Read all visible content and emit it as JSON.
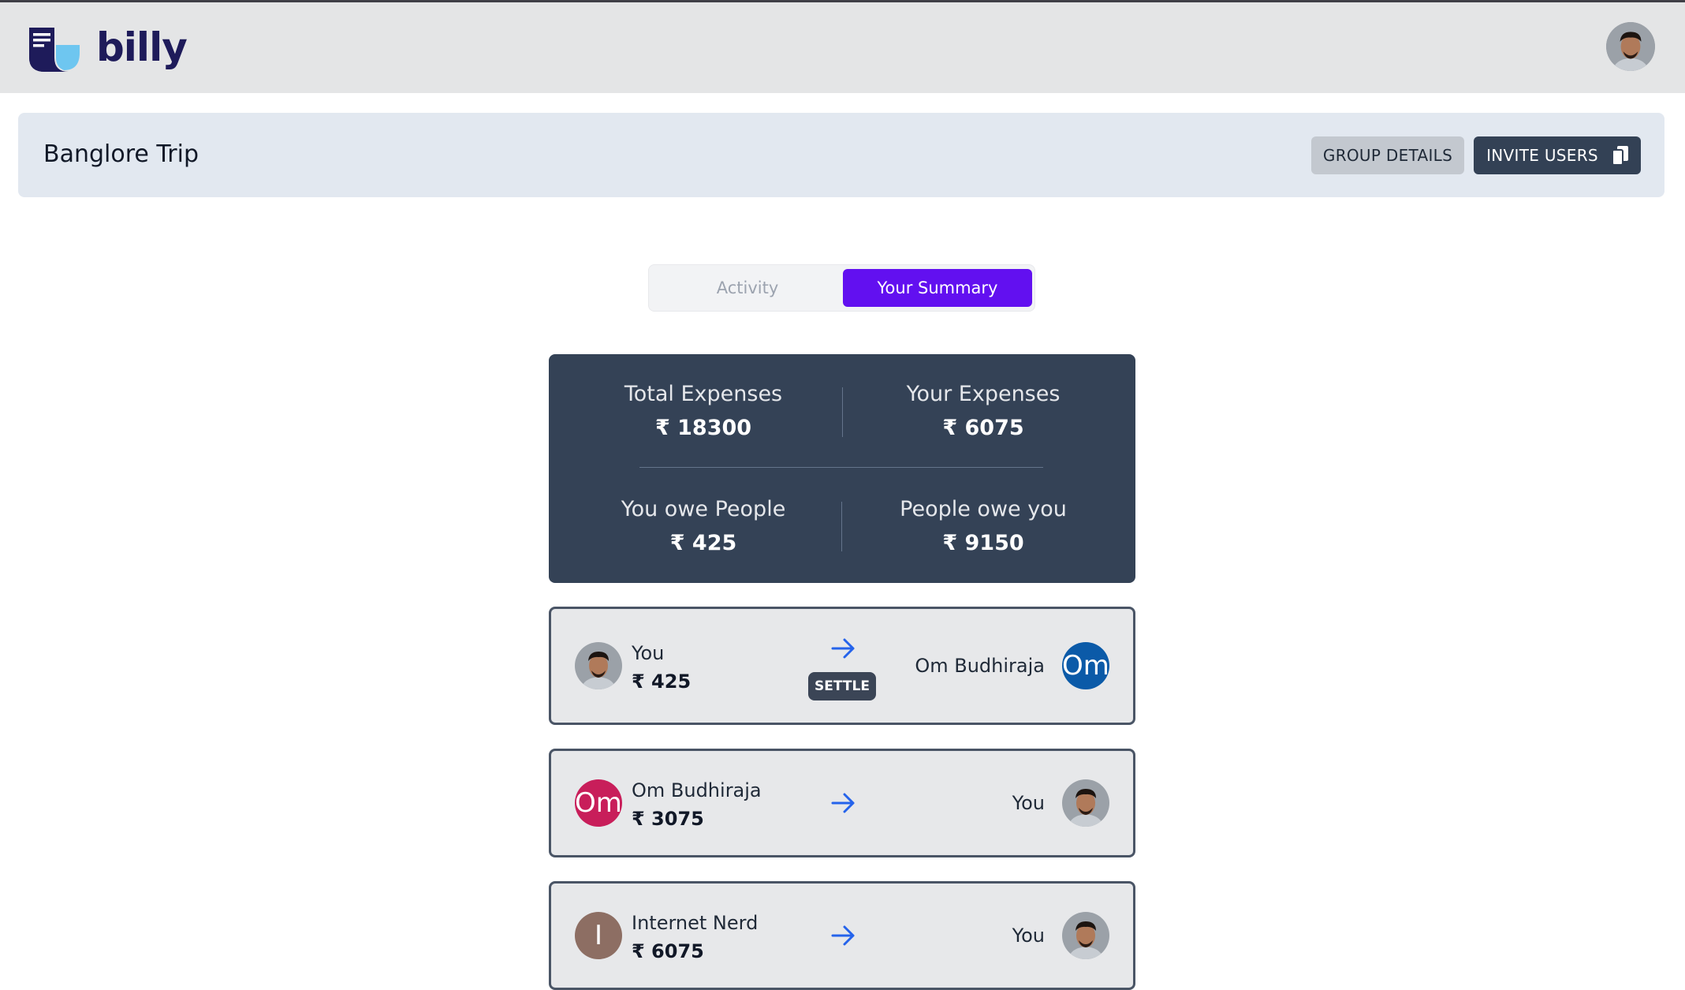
{
  "app": {
    "brand": "billy"
  },
  "group": {
    "title": "Banglore Trip",
    "details_label": "GROUP DETAILS",
    "invite_label": "INVITE USERS"
  },
  "tabs": [
    {
      "label": "Activity",
      "active": false
    },
    {
      "label": "Your Summary",
      "active": true
    }
  ],
  "summary": {
    "total_label": "Total Expenses",
    "total_value": "₹ 18300",
    "yours_label": "Your Expenses",
    "yours_value": "₹ 6075",
    "owe_label": "You owe People",
    "owe_value": "₹ 425",
    "owed_label": "People owe you",
    "owed_value": "₹ 9150"
  },
  "settlements": [
    {
      "from": "You",
      "amount": "₹ 425",
      "to": "Om Budhiraja",
      "to_initials": "Om",
      "settle_label": "SETTLE"
    },
    {
      "from": "Om Budhiraja",
      "from_initials": "Om",
      "amount": "₹ 3075",
      "to": "You"
    },
    {
      "from": "Internet Nerd",
      "from_initials": "I",
      "amount": "₹ 6075",
      "to": "You"
    }
  ],
  "colors": {
    "accent": "#6210f0",
    "card": "#344256",
    "om_blue": "#0b5aa8",
    "om_pink": "#c81e5a",
    "internet_nerd": "#8d6e63",
    "arrow": "#2563eb"
  },
  "icons": [
    "billy-logo",
    "copy-icon",
    "arrow-right-icon",
    "user-avatar"
  ]
}
